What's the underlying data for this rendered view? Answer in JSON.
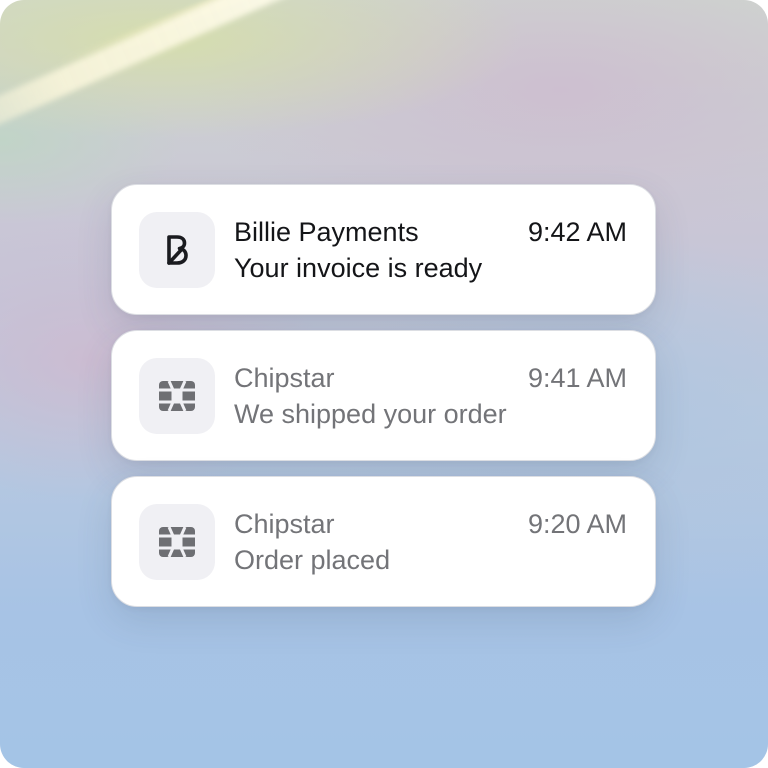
{
  "notifications": [
    {
      "app": "Billie Payments",
      "time": "9:42 AM",
      "message": "Your invoice is ready",
      "icon": "billie-logo-icon",
      "text_color": "#141518"
    },
    {
      "app": "Chipstar",
      "time": "9:41 AM",
      "message": "We shipped your order",
      "icon": "chip-icon",
      "text_color": "#737478"
    },
    {
      "app": "Chipstar",
      "time": "9:20 AM",
      "message": "Order placed",
      "icon": "chip-icon",
      "text_color": "#737478"
    }
  ],
  "colors": {
    "card_background": "#ffffff",
    "icon_tile": "#f0f0f4",
    "chip_icon": "#6e6f73",
    "billie_icon": "#1a1b1f"
  }
}
